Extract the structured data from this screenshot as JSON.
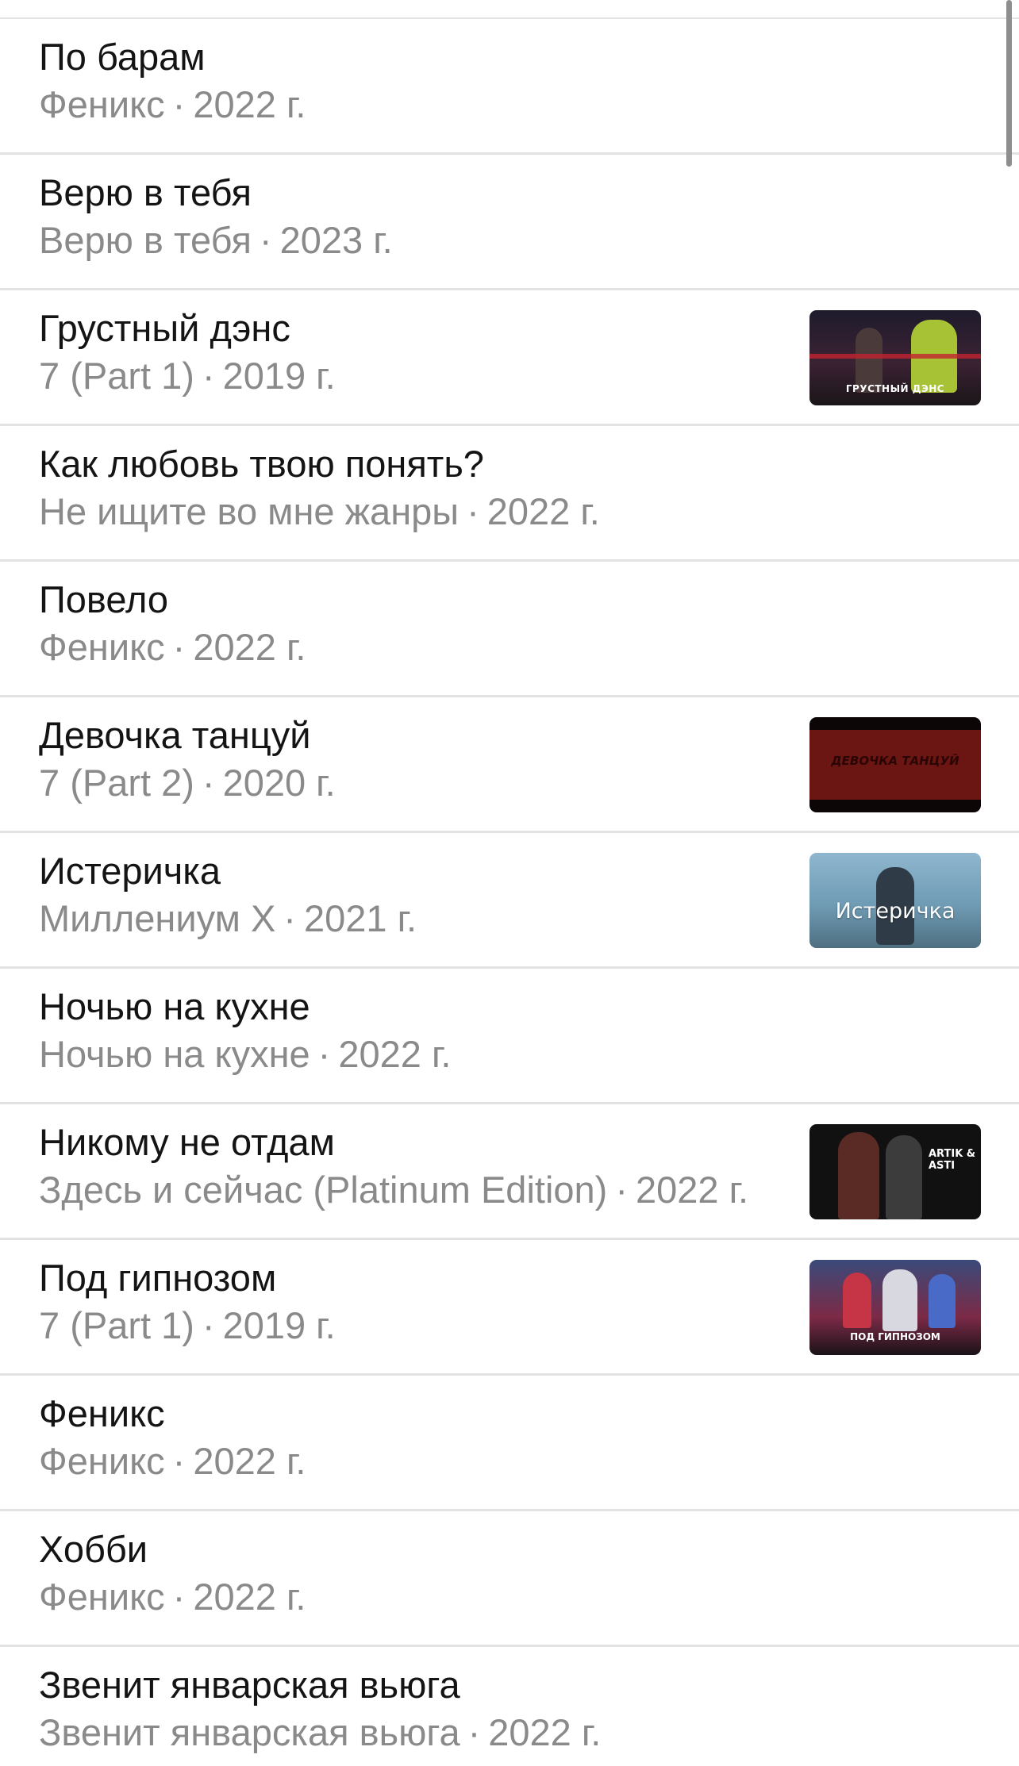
{
  "songs": [
    {
      "title": "По барам",
      "album": "Феникс",
      "year": "2022 г."
    },
    {
      "title": "Верю в тебя",
      "album": "Верю в тебя",
      "year": "2023 г."
    },
    {
      "title": "Грустный дэнс",
      "album": "7 (Part 1)",
      "year": "2019 г.",
      "thumb_text": "ГРУСТНЫЙ ДЭНС"
    },
    {
      "title": "Как любовь твою понять?",
      "album": "Не ищите во мне жанры",
      "year": "2022 г."
    },
    {
      "title": "Повело",
      "album": "Феникс",
      "year": "2022 г."
    },
    {
      "title": "Девочка танцуй",
      "album": "7 (Part 2)",
      "year": "2020 г.",
      "thumb_text": "ДЕВОЧКА ТАНЦУЙ"
    },
    {
      "title": "Истеричка",
      "album": "Миллениум X",
      "year": "2021 г.",
      "thumb_text": "Истеричка"
    },
    {
      "title": "Ночью на кухне",
      "album": "Ночью на кухне",
      "year": "2022 г."
    },
    {
      "title": "Никому не отдам",
      "album": "Здесь и сейчас (Platinum Edition)",
      "year": "2022 г.",
      "thumb_text": "ARTIK & ASTI"
    },
    {
      "title": "Под гипнозом",
      "album": "7 (Part 1)",
      "year": "2019 г.",
      "thumb_text": "ПОД ГИПНОЗОМ"
    },
    {
      "title": "Феникс",
      "album": "Феникс",
      "year": "2022 г."
    },
    {
      "title": "Хобби",
      "album": "Феникс",
      "year": "2022 г."
    },
    {
      "title": "Звенит январская вьюга",
      "album": "Звенит январская вьюга",
      "year": "2022 г."
    }
  ],
  "separator": "·",
  "colors": {
    "title": "#141414",
    "subtitle": "#8a8a8a",
    "divider": "#e3e3e3"
  }
}
